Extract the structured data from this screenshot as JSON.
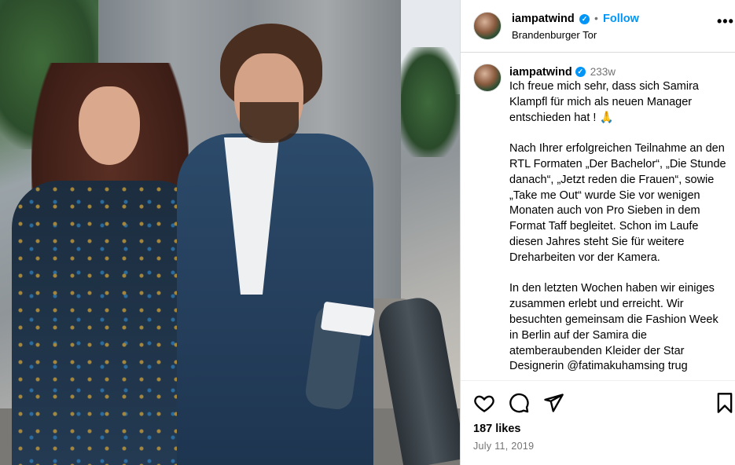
{
  "post": {
    "photo_alt": "couple",
    "header": {
      "username": "iampatwind",
      "separator": "•",
      "follow_label": "Follow",
      "location": "Brandenburger Tor",
      "more_label": "•••"
    },
    "caption": {
      "username": "iampatwind",
      "time_ago": "233w",
      "paragraphs": [
        "Ich freue mich sehr, dass sich Samira Klampfl für mich als neuen Manager entschieden hat ! 🙏",
        "Nach Ihrer erfolgreichen Teilnahme an den RTL Formaten „Der Bachelor“, „Die Stunde danach“, „Jetzt reden die Frauen“, sowie „Take me Out“ wurde Sie vor wenigen Monaten auch von Pro Sieben in dem Format Taff begleitet. Schon im Laufe diesen Jahres steht Sie für weitere Dreharbeiten vor der Kamera.",
        "In den letzten Wochen haben wir einiges zusammen erlebt und erreicht. Wir besuchten gemeinsam die Fashion Week in Berlin auf der Samira die atemberaubenden Kleider der Star Designerin @fatimakuhamsing trug"
      ]
    },
    "actions": {
      "icons": [
        "heart-icon",
        "comment-icon",
        "share-icon",
        "bookmark-icon"
      ],
      "likes": "187 likes",
      "date": "July 11, 2019"
    },
    "colors": {
      "accent": "#0095f6",
      "muted": "#737373",
      "border": "#dbdbdb"
    }
  }
}
